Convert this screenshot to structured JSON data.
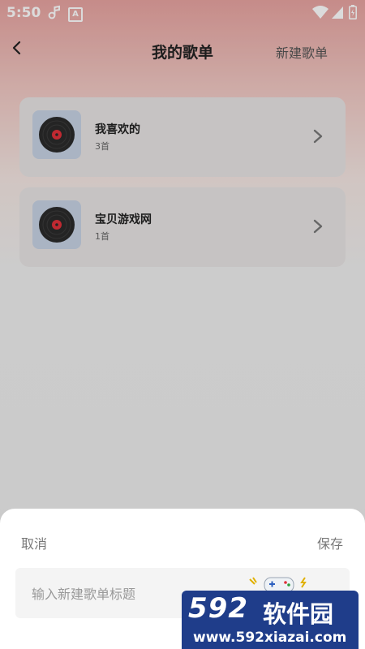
{
  "status_bar": {
    "time": "5:50",
    "icons": [
      "music-note-icon",
      "a-badge-icon",
      "wifi-icon",
      "signal-icon",
      "battery-icon"
    ]
  },
  "header": {
    "title": "我的歌单",
    "new_playlist_label": "新建歌单"
  },
  "playlists": [
    {
      "name": "我喜欢的",
      "count": "3首"
    },
    {
      "name": "宝贝游戏网",
      "count": "1首"
    }
  ],
  "sheet": {
    "cancel_label": "取消",
    "save_label": "保存",
    "input_placeholder": "输入新建歌单标题",
    "input_value": ""
  },
  "watermark": {
    "logo_text": "592",
    "cn_text": "软件园",
    "url_text": "www.592xiazai.com"
  },
  "colors": {
    "gradient_top": "#e7a3a0",
    "card_bg": "#e7e4e4",
    "sheet_bg": "#ffffff",
    "record_label": "#e0303a",
    "watermark_bg": "#1f3d8a"
  }
}
